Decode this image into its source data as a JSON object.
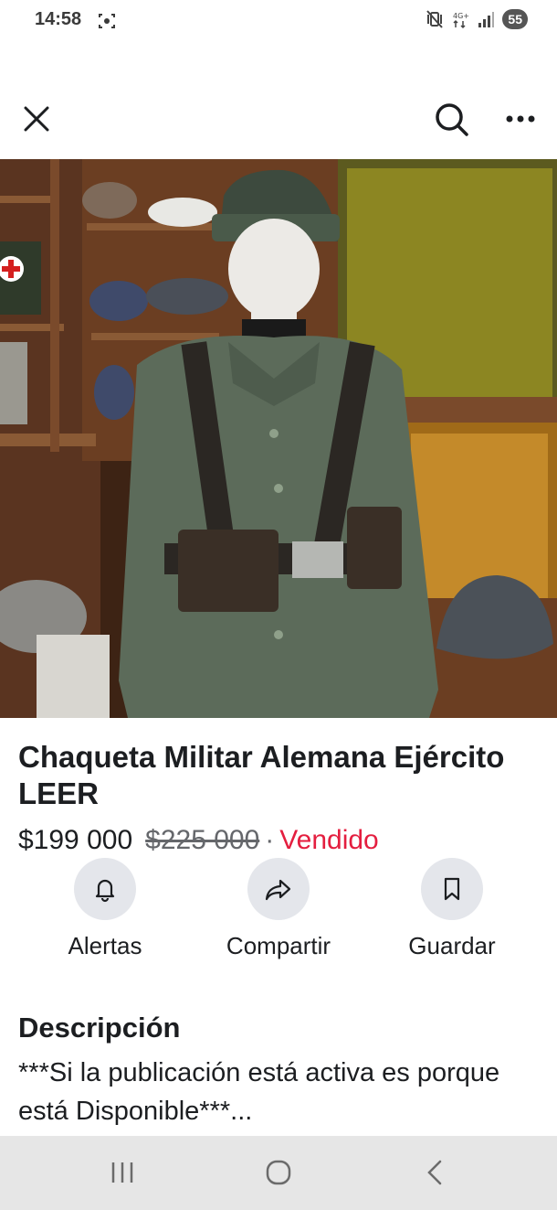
{
  "status_bar": {
    "time": "14:58",
    "battery": "55",
    "icons": [
      "screenshot-icon",
      "mute-vibrate-icon",
      "4g-data-icon",
      "signal-icon",
      "battery-icon"
    ]
  },
  "top_bar": {
    "icons": [
      "close-icon",
      "search-icon",
      "more-options-icon"
    ]
  },
  "photo": {
    "carousel_total": 8,
    "carousel_active_index": 7
  },
  "listing": {
    "title": "Chaqueta Militar Alemana Ejército LEER",
    "price": "$199 000",
    "original_price": "$225 000",
    "separator": "·",
    "status": "Vendido"
  },
  "actions": [
    {
      "label": "Alertas",
      "icon": "bell-icon"
    },
    {
      "label": "Compartir",
      "icon": "share-icon"
    },
    {
      "label": "Guardar",
      "icon": "bookmark-icon"
    }
  ],
  "description": {
    "heading": "Descripción",
    "text": "***Si la publicación está activa es porque está Disponible***..."
  },
  "nav_bar": {
    "icons": [
      "recent-apps-icon",
      "home-icon",
      "back-icon"
    ]
  },
  "colors": {
    "sold": "#e41e3f",
    "action_bg": "#e4e6eb",
    "nav_bg": "#e6e6e6"
  }
}
